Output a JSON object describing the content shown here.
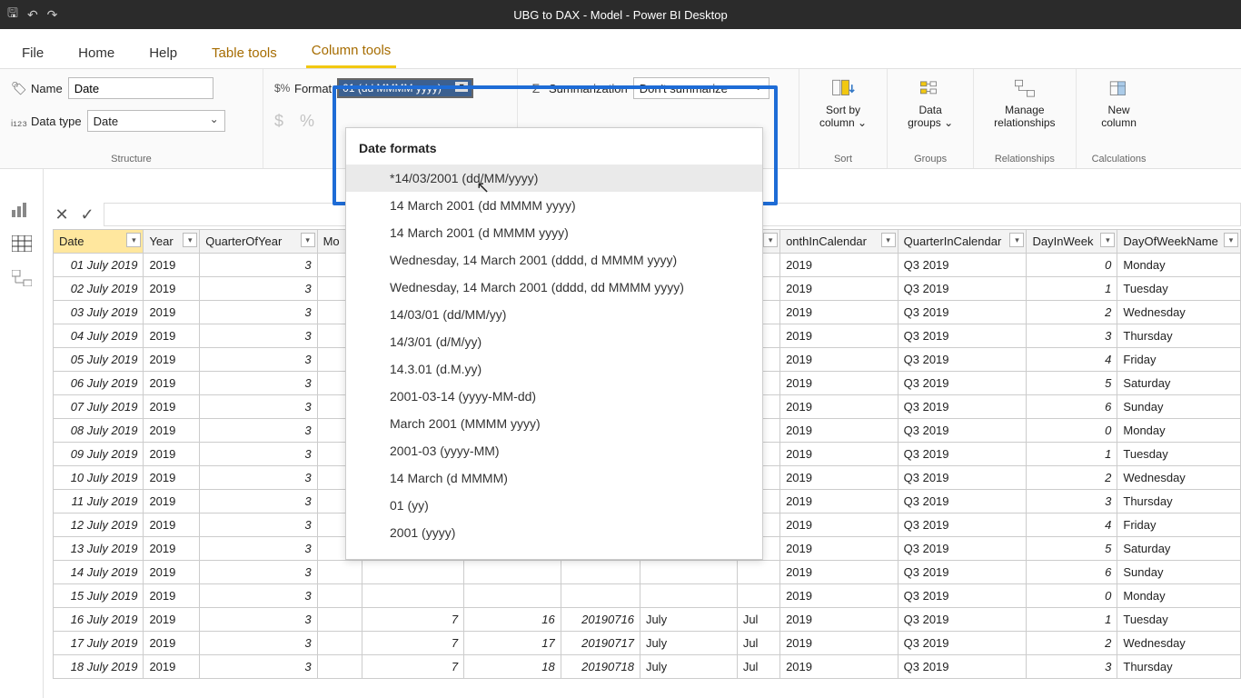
{
  "titlebar": {
    "title": "UBG to DAX - Model - Power BI Desktop"
  },
  "tabs": {
    "file": "File",
    "home": "Home",
    "help": "Help",
    "table_tools": "Table tools",
    "column_tools": "Column tools"
  },
  "ribbon": {
    "structure": {
      "group_label": "Structure",
      "name_label": "Name",
      "name_value": "Date",
      "datatype_label": "Data type",
      "datatype_value": "Date"
    },
    "formatting": {
      "format_label": "Format",
      "format_value": "01 (dd MMMM yyyy)",
      "currency_sym": "$",
      "percent_sym": "%"
    },
    "summarization": {
      "label": "Summarization",
      "value": "Don't summarize"
    },
    "sort": {
      "group_label": "Sort",
      "btn": "Sort by\ncolumn"
    },
    "groups": {
      "group_label": "Groups",
      "btn": "Data\ngroups"
    },
    "rel": {
      "group_label": "Relationships",
      "btn": "Manage\nrelationships"
    },
    "calc": {
      "group_label": "Calculations",
      "btn": "New\ncolumn"
    }
  },
  "dropdown": {
    "header": "Date formats",
    "items": [
      "*14/03/2001 (dd/MM/yyyy)",
      "14 March 2001 (dd MMMM yyyy)",
      "14 March 2001 (d MMMM yyyy)",
      "Wednesday, 14 March 2001 (dddd, d MMMM yyyy)",
      "Wednesday, 14 March 2001 (dddd, dd MMMM yyyy)",
      "14/03/01 (dd/MM/yy)",
      "14/3/01 (d/M/yy)",
      "14.3.01 (d.M.yy)",
      "2001-03-14 (yyyy-MM-dd)",
      "March 2001 (MMMM yyyy)",
      "2001-03 (yyyy-MM)",
      "14 March (d MMMM)",
      "01 (yy)",
      "2001 (yyyy)"
    ]
  },
  "columns": [
    "Date",
    "Year",
    "QuarterOfYear",
    "Mo",
    "",
    "",
    "",
    "",
    "",
    "onthInCalendar",
    "QuarterInCalendar",
    "DayInWeek",
    "DayOfWeekName"
  ],
  "rows": [
    {
      "date": "01 July 2019",
      "year": "2019",
      "q": "3",
      "mic": "2019",
      "qic": "Q3 2019",
      "diw": "0",
      "down": "Monday"
    },
    {
      "date": "02 July 2019",
      "year": "2019",
      "q": "3",
      "mic": "2019",
      "qic": "Q3 2019",
      "diw": "1",
      "down": "Tuesday"
    },
    {
      "date": "03 July 2019",
      "year": "2019",
      "q": "3",
      "mic": "2019",
      "qic": "Q3 2019",
      "diw": "2",
      "down": "Wednesday"
    },
    {
      "date": "04 July 2019",
      "year": "2019",
      "q": "3",
      "mic": "2019",
      "qic": "Q3 2019",
      "diw": "3",
      "down": "Thursday"
    },
    {
      "date": "05 July 2019",
      "year": "2019",
      "q": "3",
      "mic": "2019",
      "qic": "Q3 2019",
      "diw": "4",
      "down": "Friday"
    },
    {
      "date": "06 July 2019",
      "year": "2019",
      "q": "3",
      "mic": "2019",
      "qic": "Q3 2019",
      "diw": "5",
      "down": "Saturday"
    },
    {
      "date": "07 July 2019",
      "year": "2019",
      "q": "3",
      "mic": "2019",
      "qic": "Q3 2019",
      "diw": "6",
      "down": "Sunday"
    },
    {
      "date": "08 July 2019",
      "year": "2019",
      "q": "3",
      "mic": "2019",
      "qic": "Q3 2019",
      "diw": "0",
      "down": "Monday"
    },
    {
      "date": "09 July 2019",
      "year": "2019",
      "q": "3",
      "mic": "2019",
      "qic": "Q3 2019",
      "diw": "1",
      "down": "Tuesday"
    },
    {
      "date": "10 July 2019",
      "year": "2019",
      "q": "3",
      "mic": "2019",
      "qic": "Q3 2019",
      "diw": "2",
      "down": "Wednesday"
    },
    {
      "date": "11 July 2019",
      "year": "2019",
      "q": "3",
      "mic": "2019",
      "qic": "Q3 2019",
      "diw": "3",
      "down": "Thursday"
    },
    {
      "date": "12 July 2019",
      "year": "2019",
      "q": "3",
      "mic": "2019",
      "qic": "Q3 2019",
      "diw": "4",
      "down": "Friday"
    },
    {
      "date": "13 July 2019",
      "year": "2019",
      "q": "3",
      "mic": "2019",
      "qic": "Q3 2019",
      "diw": "5",
      "down": "Saturday"
    },
    {
      "date": "14 July 2019",
      "year": "2019",
      "q": "3",
      "mic": "2019",
      "qic": "Q3 2019",
      "diw": "6",
      "down": "Sunday"
    },
    {
      "date": "15 July 2019",
      "year": "2019",
      "q": "3",
      "mic": "2019",
      "qic": "Q3 2019",
      "diw": "0",
      "down": "Monday"
    },
    {
      "date": "16 July 2019",
      "year": "2019",
      "q": "3",
      "mn": "7",
      "dn": "16",
      "dy": "20190716",
      "mname": "July",
      "msh": "Jul",
      "mic": "2019",
      "qic": "Q3 2019",
      "diw": "1",
      "down": "Tuesday"
    },
    {
      "date": "17 July 2019",
      "year": "2019",
      "q": "3",
      "mn": "7",
      "dn": "17",
      "dy": "20190717",
      "mname": "July",
      "msh": "Jul",
      "mic": "2019",
      "qic": "Q3 2019",
      "diw": "2",
      "down": "Wednesday"
    },
    {
      "date": "18 July 2019",
      "year": "2019",
      "q": "3",
      "mn": "7",
      "dn": "18",
      "dy": "20190718",
      "mname": "July",
      "msh": "Jul",
      "mic": "2019",
      "qic": "Q3 2019",
      "diw": "3",
      "down": "Thursday"
    }
  ]
}
